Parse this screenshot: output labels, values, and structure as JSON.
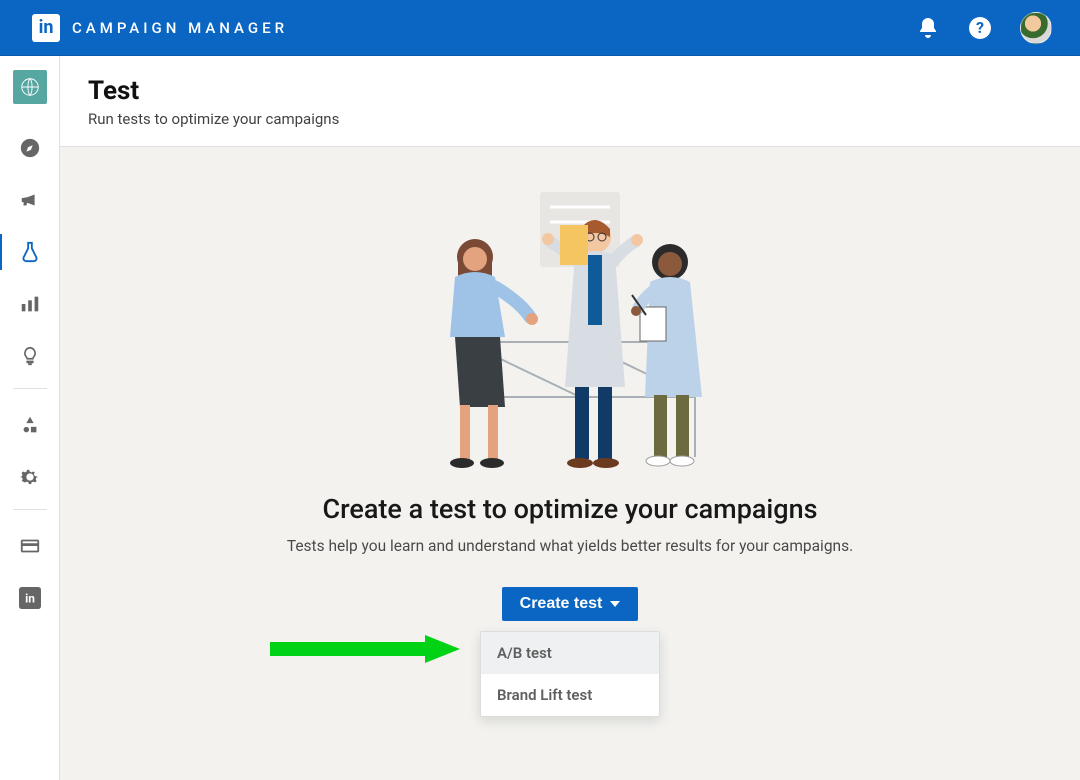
{
  "header": {
    "app_title": "CAMPAIGN MANAGER",
    "logo_text": "in"
  },
  "page": {
    "title": "Test",
    "subtitle": "Run tests to optimize your campaigns"
  },
  "hero": {
    "heading": "Create a test to optimize your campaigns",
    "description": "Tests help you learn and understand what yields better results for your campaigns.",
    "button_label": "Create test"
  },
  "dropdown": {
    "items": [
      "A/B test",
      "Brand Lift test"
    ],
    "highlighted_index": 0
  },
  "sidebar": {
    "items": [
      {
        "name": "brand",
        "icon": "globe"
      },
      {
        "name": "discover",
        "icon": "compass"
      },
      {
        "name": "advertise",
        "icon": "megaphone"
      },
      {
        "name": "test",
        "icon": "flask",
        "active": true
      },
      {
        "name": "analyze",
        "icon": "bars"
      },
      {
        "name": "ideas",
        "icon": "lightbulb"
      },
      {
        "name": "divider"
      },
      {
        "name": "assets",
        "icon": "shapes"
      },
      {
        "name": "settings",
        "icon": "gear"
      },
      {
        "name": "divider"
      },
      {
        "name": "billing",
        "icon": "card"
      },
      {
        "name": "linkedin",
        "icon": "li"
      }
    ]
  }
}
